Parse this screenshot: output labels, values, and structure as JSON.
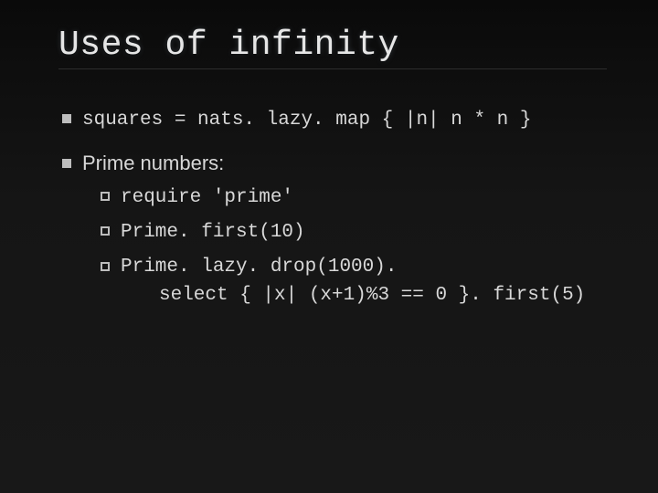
{
  "title": "Uses of infinity",
  "bullets": [
    {
      "text": "squares = nats. lazy. map { |n| n * n }",
      "style": "mono"
    },
    {
      "text": "Prime numbers:",
      "style": "sans",
      "children": [
        {
          "text": "require 'prime'"
        },
        {
          "text": "Prime. first(10)"
        },
        {
          "text": "Prime. lazy. drop(1000).",
          "cont": "select { |x| (x+1)%3 == 0 }. first(5)"
        }
      ]
    }
  ]
}
